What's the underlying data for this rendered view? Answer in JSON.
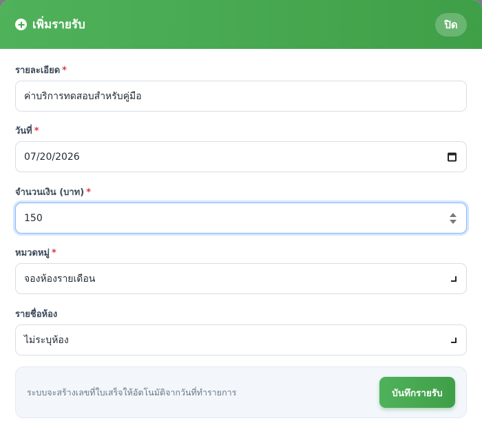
{
  "header": {
    "title": "เพิ่มรายรับ",
    "close_label": "ปิด"
  },
  "form": {
    "description": {
      "label": "รายละเอียด",
      "required_mark": "*",
      "value": "ค่าบริการทดสอบสำหรับคู่มือ"
    },
    "date": {
      "label": "วันที่",
      "required_mark": "*",
      "value": "07/20/2026"
    },
    "amount": {
      "label": "จำนวนเงิน (บาท)",
      "required_mark": "*",
      "value": "150"
    },
    "category": {
      "label": "หมวดหมู่",
      "required_mark": "*",
      "selected": "จองห้องรายเดือน"
    },
    "room": {
      "label": "รายชื่อห้อง",
      "selected": "ไม่ระบุห้อง"
    }
  },
  "footer": {
    "note": "ระบบจะสร้างเลขที่ใบเสร็จให้อัตโนมัติจากวันที่ทำรายการ",
    "save_label": "บันทึกรายรับ"
  },
  "colors": {
    "accent": "#46a94f",
    "required": "#dc3545"
  },
  "icons": {
    "title": "plus-circle-icon",
    "date": "calendar-icon",
    "amount": "spinner-icon",
    "select": "chevron-down-icon"
  }
}
